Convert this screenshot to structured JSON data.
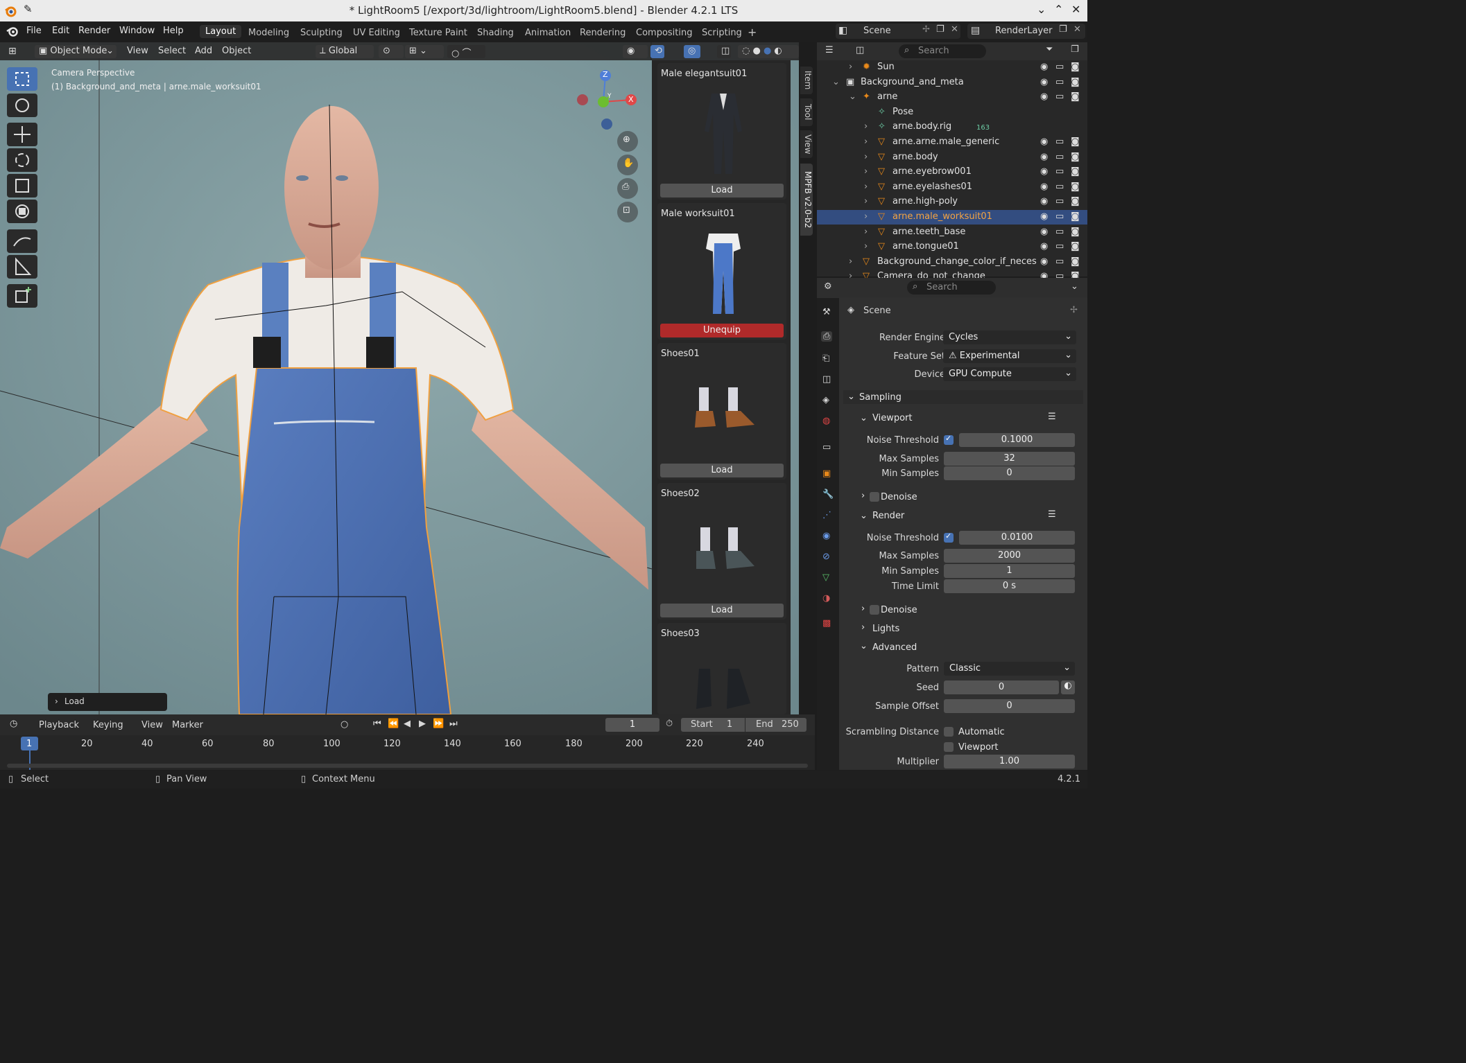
{
  "window": {
    "title": "* LightRoom5 [/export/3d/lightroom/LightRoom5.blend] - Blender 4.2.1 LTS"
  },
  "menu": [
    "File",
    "Edit",
    "Render",
    "Window",
    "Help"
  ],
  "workspaces": [
    "Layout",
    "Modeling",
    "Sculpting",
    "UV Editing",
    "Texture Paint",
    "Shading",
    "Animation",
    "Rendering",
    "Compositing",
    "Scripting"
  ],
  "scene": {
    "name": "Scene",
    "render_layer": "RenderLayer"
  },
  "viewport_header": {
    "mode": "Object Mode",
    "menus": [
      "View",
      "Select",
      "Add",
      "Object"
    ],
    "orientation": "Global"
  },
  "viewport": {
    "overlay_title": "Camera Perspective",
    "overlay_info": "(1) Background_and_meta | arne.male_worksuit01",
    "operator_panel": "Load",
    "gizmo": {
      "z": "Z",
      "y": "Y",
      "x": "X"
    }
  },
  "side_tabs": [
    "Item",
    "Tool",
    "View",
    "MPFB v2.0-b2"
  ],
  "assets": [
    {
      "name": "Male elegantsuit01",
      "button": "Load",
      "equipped": false
    },
    {
      "name": "Male worksuit01",
      "button": "Unequip",
      "equipped": true
    },
    {
      "name": "Shoes01",
      "button": "Load",
      "equipped": false
    },
    {
      "name": "Shoes02",
      "button": "Load",
      "equipped": false
    },
    {
      "name": "Shoes03",
      "button": "",
      "equipped": false
    }
  ],
  "outliner": {
    "search_placeholder": "Search",
    "rows": [
      {
        "label": "Sun",
        "indent": 1
      },
      {
        "label": "Background_and_meta",
        "indent": 0
      },
      {
        "label": "arne",
        "indent": 2
      },
      {
        "label": "Pose",
        "indent": 3
      },
      {
        "label": "arne.body.rig",
        "indent": 3,
        "badge": "163"
      },
      {
        "label": "arne.arne.male_generic",
        "indent": 3
      },
      {
        "label": "arne.body",
        "indent": 3
      },
      {
        "label": "arne.eyebrow001",
        "indent": 3
      },
      {
        "label": "arne.eyelashes01",
        "indent": 3
      },
      {
        "label": "arne.high-poly",
        "indent": 3
      },
      {
        "label": "arne.male_worksuit01",
        "indent": 3,
        "selected": true
      },
      {
        "label": "arne.teeth_base",
        "indent": 3
      },
      {
        "label": "arne.tongue01",
        "indent": 3
      },
      {
        "label": "Background_change_color_if_neces",
        "indent": 1
      },
      {
        "label": "Camera_do_not_change",
        "indent": 1
      }
    ]
  },
  "properties": {
    "search_placeholder": "Search",
    "context": "Scene",
    "render_engine": {
      "label": "Render Engine",
      "value": "Cycles"
    },
    "feature_set": {
      "label": "Feature Set",
      "value": "Experimental"
    },
    "device": {
      "label": "Device",
      "value": "GPU Compute"
    },
    "sampling": "Sampling",
    "viewport_section": "Viewport",
    "vp_noise_label": "Noise Threshold",
    "vp_noise": "0.1000",
    "vp_max_label": "Max Samples",
    "vp_max": "32",
    "vp_min_label": "Min Samples",
    "vp_min": "0",
    "denoise": "Denoise",
    "render_section": "Render",
    "r_noise_label": "Noise Threshold",
    "r_noise": "0.0100",
    "r_max_label": "Max Samples",
    "r_max": "2000",
    "r_min_label": "Min Samples",
    "r_min": "1",
    "r_time_label": "Time Limit",
    "r_time": "0 s",
    "lights": "Lights",
    "advanced": "Advanced",
    "pattern_label": "Pattern",
    "pattern": "Classic",
    "seed_label": "Seed",
    "seed": "0",
    "offset_label": "Sample Offset",
    "offset": "0",
    "scrambling_label": "Scrambling Distance",
    "automatic": "Automatic",
    "viewport_chk": "Viewport",
    "multiplier_label": "Multiplier",
    "multiplier": "1.00"
  },
  "timeline": {
    "menus": [
      "Playback",
      "Keying",
      "View",
      "Marker"
    ],
    "current_frame": "1",
    "start_label": "Start",
    "start": "1",
    "end_label": "End",
    "end": "250",
    "ruler": [
      "1",
      "20",
      "40",
      "60",
      "80",
      "100",
      "120",
      "140",
      "160",
      "180",
      "200",
      "220",
      "240"
    ]
  },
  "statusbar": {
    "select": "Select",
    "pan": "Pan View",
    "context": "Context Menu",
    "version": "4.2.1"
  },
  "colors": {
    "accent": "#4772b3",
    "selection_outline": "#f5a442",
    "unequip": "#b02a2a"
  }
}
